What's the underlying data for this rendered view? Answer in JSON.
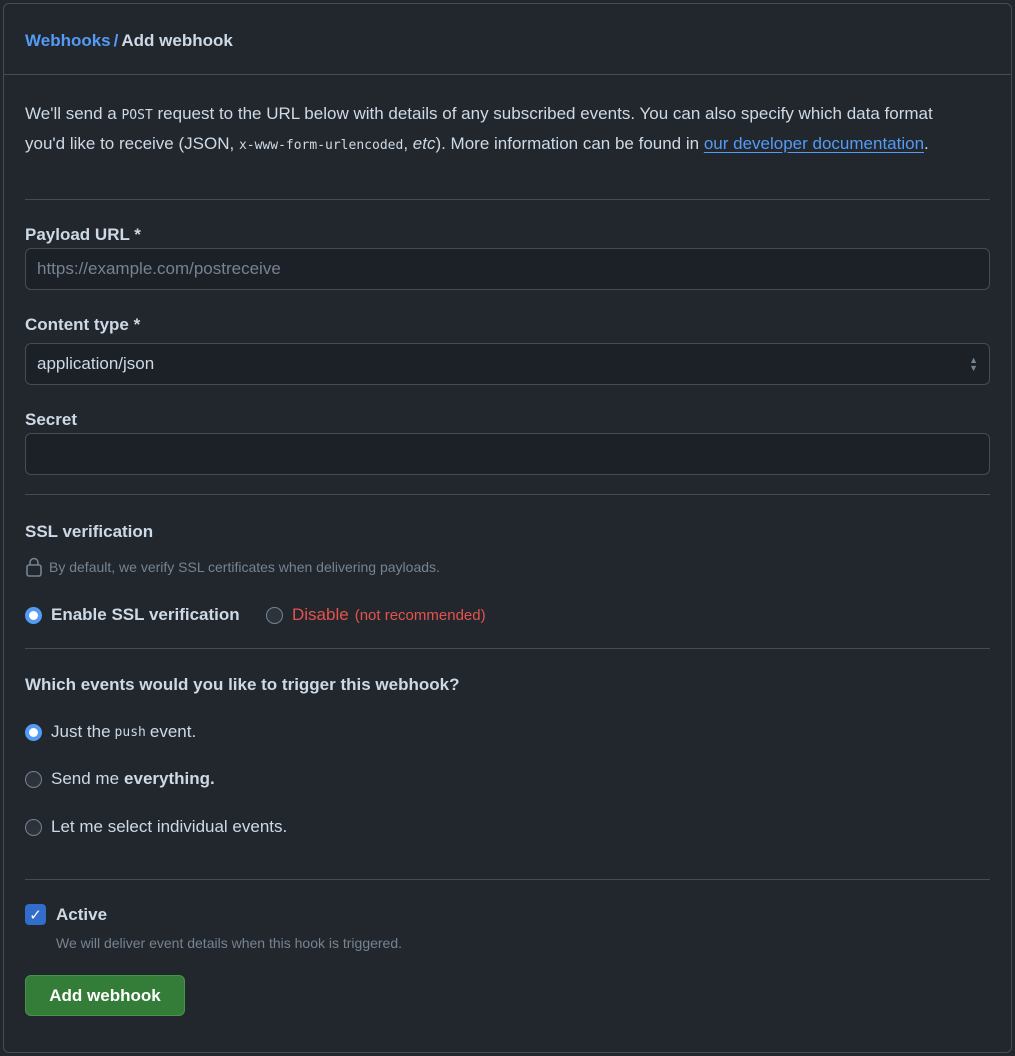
{
  "breadcrumb": {
    "parent": "Webhooks",
    "separator": "/",
    "current": "Add webhook"
  },
  "intro": {
    "part1": "We'll send a ",
    "post_code": "POST",
    "part2": " request to the URL below with details of any subscribed events. You can also specify which data format you'd like to receive (JSON, ",
    "form_code": "x-www-form-urlencoded",
    "part3": ", ",
    "etc": "etc",
    "part4": "). More information can be found in ",
    "link_text": "our developer documentation",
    "part5": "."
  },
  "payload_url": {
    "label": "Payload URL *",
    "placeholder": "https://example.com/postreceive",
    "value": ""
  },
  "content_type": {
    "label": "Content type *",
    "selected": "application/json"
  },
  "secret": {
    "label": "Secret",
    "value": ""
  },
  "ssl": {
    "title": "SSL verification",
    "note": "By default, we verify SSL certificates when delivering payloads.",
    "enable_label": "Enable SSL verification",
    "disable_label": "Disable",
    "disable_note": "(not recommended)",
    "selected": "enable"
  },
  "events": {
    "question": "Which events would you like to trigger this webhook?",
    "options": {
      "push_pre": "Just the ",
      "push_code": "push",
      "push_post": " event.",
      "everything_pre": "Send me ",
      "everything_bold": "everything.",
      "individual": "Let me select individual events."
    },
    "selected": "push"
  },
  "active": {
    "label": "Active",
    "checked": true,
    "description": "We will deliver event details when this hook is triggered."
  },
  "submit": {
    "label": "Add webhook"
  },
  "colors": {
    "link": "#539bf5",
    "danger": "#e5534b",
    "primary_button": "#347d39",
    "checkbox": "#316dca"
  }
}
